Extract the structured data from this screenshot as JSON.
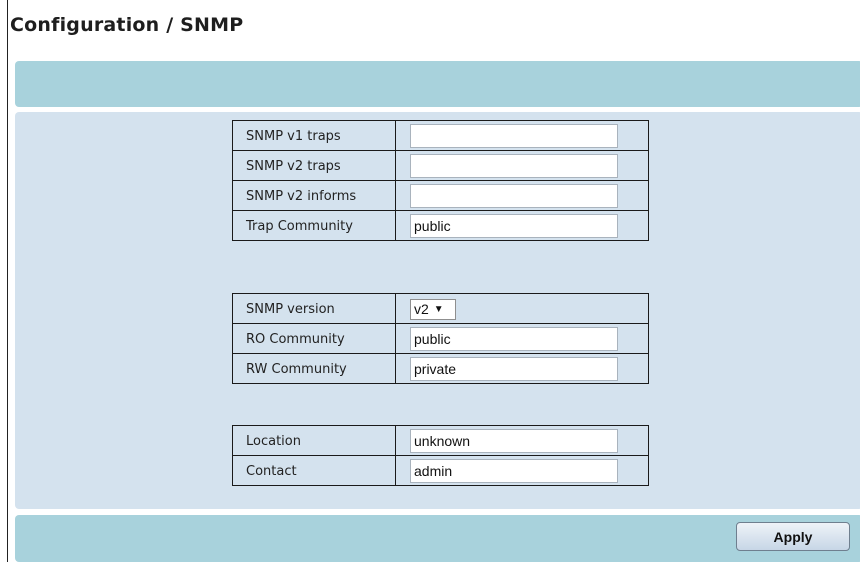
{
  "page": {
    "title": "Configuration / SNMP"
  },
  "traps": {
    "v1_label": "SNMP v1 traps",
    "v1_value": "",
    "v2_label": "SNMP v2 traps",
    "v2_value": "",
    "informs_label": "SNMP v2 informs",
    "informs_value": "",
    "community_label": "Trap Community",
    "community_value": "public"
  },
  "access": {
    "version_label": "SNMP version",
    "version_value": "v2",
    "ro_label": "RO Community",
    "ro_value": "public",
    "rw_label": "RW Community",
    "rw_value": "private"
  },
  "system": {
    "location_label": "Location",
    "location_value": "unknown",
    "contact_label": "Contact",
    "contact_value": "admin"
  },
  "footer": {
    "apply_label": "Apply"
  },
  "colors": {
    "bar": "#a8d2dc",
    "panel": "#d4e2ee"
  }
}
